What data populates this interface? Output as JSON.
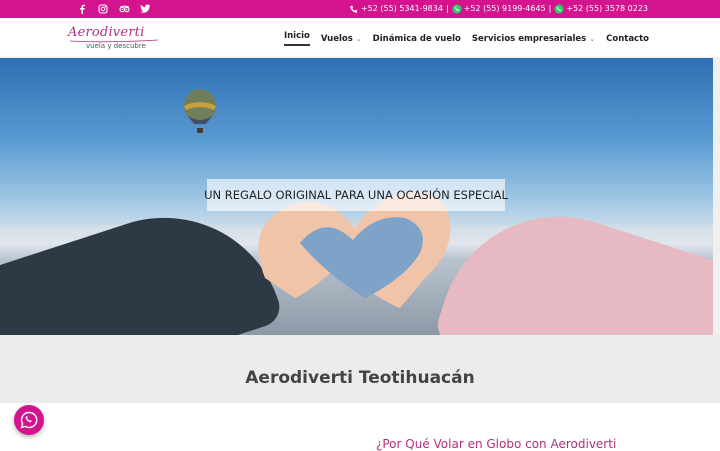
{
  "topbar": {
    "social_icons": [
      "facebook-icon",
      "instagram-icon",
      "tripadvisor-icon",
      "twitter-icon"
    ],
    "phones": [
      "+52 (55) 5341-9834",
      "+52 (55) 9199-4645",
      "+52 (55) 3578 0223"
    ],
    "separator": "|"
  },
  "logo": {
    "script_text": "Aerodiverti",
    "tagline": "vuela y descubre"
  },
  "nav": {
    "items": [
      {
        "label": "Inicio",
        "active": true,
        "dropdown": false
      },
      {
        "label": "Vuelos",
        "active": false,
        "dropdown": true
      },
      {
        "label": "Dinámica de vuelo",
        "active": false,
        "dropdown": false
      },
      {
        "label": "Servicios empresariales",
        "active": false,
        "dropdown": true
      },
      {
        "label": "Contacto",
        "active": false,
        "dropdown": false
      }
    ]
  },
  "hero": {
    "caption": "UN REGALO ORIGINAL PARA UNA OCASIÓN ESPECIAL"
  },
  "section": {
    "title": "Aerodiverti Teotihuacán"
  },
  "content": {
    "subheading": "¿Por Qué Volar en Globo con Aerodiverti"
  },
  "colors": {
    "brand": "#d4148f",
    "brand_text": "#b0307f"
  }
}
